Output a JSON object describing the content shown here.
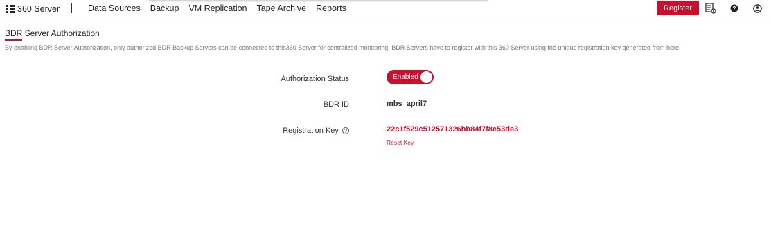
{
  "app": {
    "title": "360 Server"
  },
  "nav": {
    "items": [
      "Data Sources",
      "Backup",
      "VM Replication",
      "Tape Archive",
      "Reports"
    ]
  },
  "toolbar": {
    "register_label": "Register",
    "icons": [
      "settings-document-icon",
      "help-icon",
      "user-icon"
    ]
  },
  "page": {
    "title": "BDR Server Authorization",
    "description": "By enabling BDR Server Authorization, only authorized BDR Backup Servers can be connected to this360 Server for centralized monitoring. BDR Servers have to register with this 360 Server using the unique registration key generated from here."
  },
  "form": {
    "auth_status_label": "Authorization Status",
    "auth_status_value": "Enabled",
    "bdr_id_label": "BDR ID",
    "bdr_id_value": "mbs_april7",
    "reg_key_label": "Registration Key",
    "reg_key_value": "22c1f529c512571326bb84f7f8e53de3",
    "reset_key_label": "Reset Key"
  },
  "colors": {
    "accent": "#c8102e"
  }
}
